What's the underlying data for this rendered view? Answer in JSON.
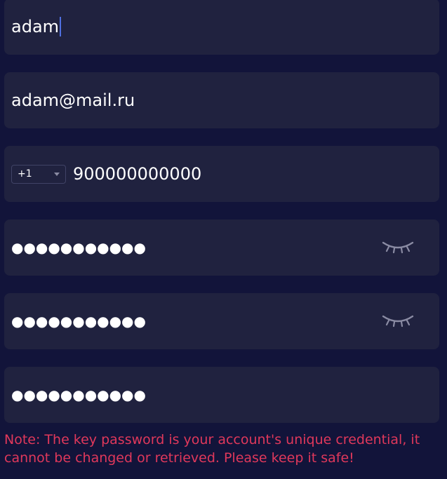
{
  "form": {
    "username": {
      "value": "adam"
    },
    "email": {
      "value": "adam@mail.ru"
    },
    "phone": {
      "country_code": "+1",
      "number": "900000000000"
    },
    "password": {
      "masked_value": "●●●●●●●●●●●",
      "toggle_icon": "eye-closed-icon"
    },
    "confirm_password": {
      "masked_value": "●●●●●●●●●●●",
      "toggle_icon": "eye-closed-icon"
    },
    "key_password": {
      "masked_value": "●●●●●●●●●●●"
    },
    "note": "Note: The key password is your account's unique credential, it cannot be changed or retrieved. Please keep it safe!"
  },
  "colors": {
    "page_background": "#12143a",
    "field_background": "#20223f",
    "text": "#ffffff",
    "note": "#e0385b",
    "caret": "#4f6fe0",
    "icon": "#8a8ba3"
  }
}
